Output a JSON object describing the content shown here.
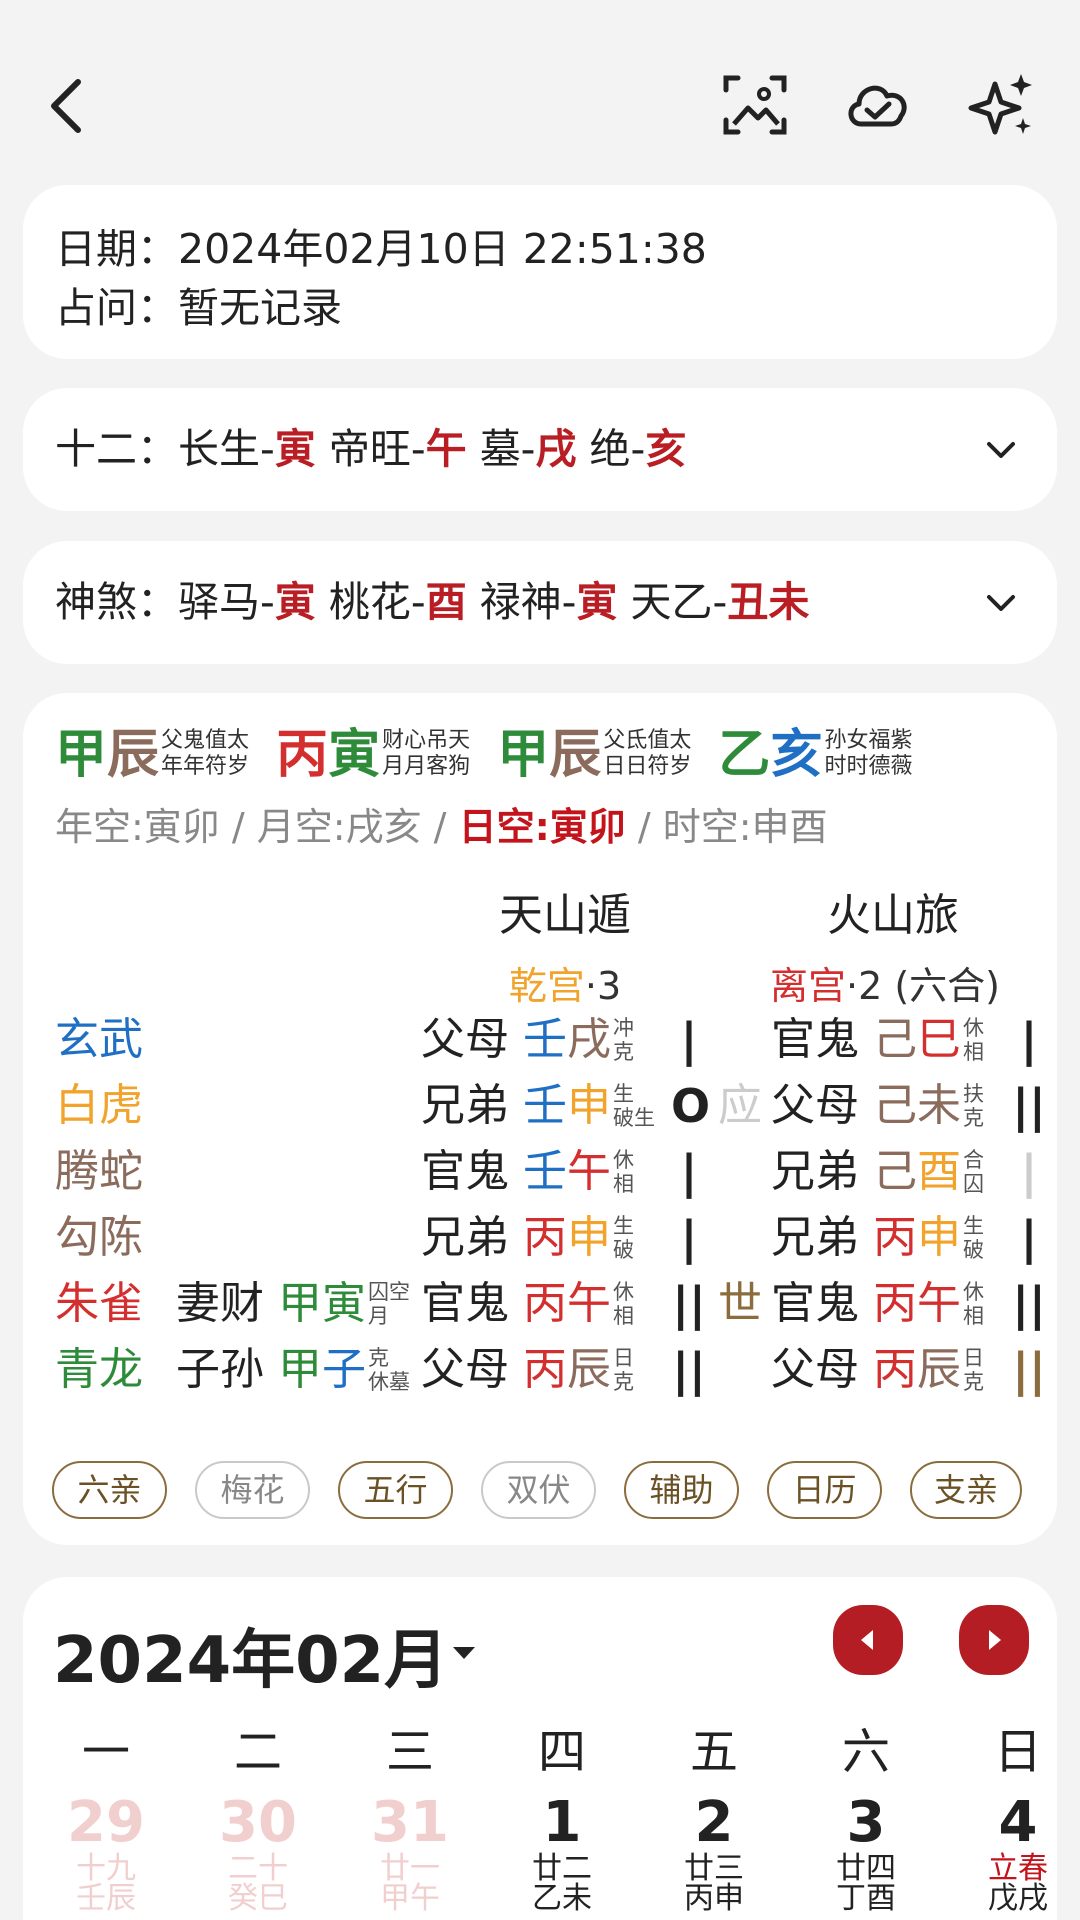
{
  "info": {
    "date_label": "日期：",
    "date_value": "2024年02月10日 22:51:38",
    "question_label": "占问：",
    "question_value": "暂无记录"
  },
  "twelve": {
    "label": "十二：",
    "items": [
      {
        "name": "长生-",
        "branch": "寅"
      },
      {
        "name": "帝旺-",
        "branch": "午"
      },
      {
        "name": "墓-",
        "branch": "戌"
      },
      {
        "name": "绝-",
        "branch": "亥"
      }
    ]
  },
  "shensha": {
    "label": "神煞：",
    "items": [
      {
        "name": "驿马-",
        "branch": "寅"
      },
      {
        "name": "桃花-",
        "branch": "酉"
      },
      {
        "name": "禄神-",
        "branch": "寅"
      },
      {
        "name": "天乙-",
        "branch": "丑未"
      }
    ]
  },
  "pillars": [
    {
      "stem": "甲",
      "branch": "辰",
      "sub1": "父鬼值太",
      "sub2": "年年符岁"
    },
    {
      "stem": "丙",
      "branch": "寅",
      "sub1": "财心吊天",
      "sub2": "月月客狗"
    },
    {
      "stem": "甲",
      "branch": "辰",
      "sub1": "父氐值太",
      "sub2": "日日符岁"
    },
    {
      "stem": "乙",
      "branch": "亥",
      "sub1": "孙女福紫",
      "sub2": "时时德薇"
    }
  ],
  "kong": {
    "year": "年空:寅卯",
    "sep": " / ",
    "month": "月空:戌亥",
    "day": "日空:寅卯",
    "hour": "时空:申酉"
  },
  "gua": {
    "main_name": "天山遁",
    "main_palace": "乾宫",
    "main_num": "·3",
    "change_name": "火山旅",
    "change_palace": "离宫",
    "change_num": "·2 (六合)"
  },
  "yao": [
    {
      "god": "玄武",
      "fu": "",
      "fu_s": "",
      "fu_b": "",
      "fu_sup1": "",
      "fu_sup2": "",
      "rel": "父母",
      "stem": "壬",
      "branch": "戌",
      "sup1": "冲",
      "sup2": "克",
      "sym": "|",
      "mark": "",
      "c_rel": "官鬼",
      "c_stem": "己",
      "c_branch": "巳",
      "c_sup1": "休",
      "c_sup2": "相",
      "c_sym": "|"
    },
    {
      "god": "白虎",
      "fu": "",
      "fu_s": "",
      "fu_b": "",
      "fu_sup1": "",
      "fu_sup2": "",
      "rel": "兄弟",
      "stem": "壬",
      "branch": "申",
      "sup1": "生",
      "sup2": "破生",
      "sym": "O",
      "mark": "应",
      "c_rel": "父母",
      "c_stem": "己",
      "c_branch": "未",
      "c_sup1": "扶",
      "c_sup2": "克",
      "c_sym": "||"
    },
    {
      "god": "腾蛇",
      "fu": "",
      "fu_s": "",
      "fu_b": "",
      "fu_sup1": "",
      "fu_sup2": "",
      "rel": "官鬼",
      "stem": "壬",
      "branch": "午",
      "sup1": "休",
      "sup2": "相",
      "sym": "|",
      "mark": "",
      "c_rel": "兄弟",
      "c_stem": "己",
      "c_branch": "酉",
      "c_sup1": "合",
      "c_sup2": "囚",
      "c_sym": "|"
    },
    {
      "god": "勾陈",
      "fu": "",
      "fu_s": "",
      "fu_b": "",
      "fu_sup1": "",
      "fu_sup2": "",
      "rel": "兄弟",
      "stem": "丙",
      "branch": "申",
      "sup1": "生",
      "sup2": "破",
      "sym": "|",
      "mark": "",
      "c_rel": "兄弟",
      "c_stem": "丙",
      "c_branch": "申",
      "c_sup1": "生",
      "c_sup2": "破",
      "c_sym": "|"
    },
    {
      "god": "朱雀",
      "fu": "妻财",
      "fu_s": "甲",
      "fu_b": "寅",
      "fu_sup1": "囚空",
      "fu_sup2": "月",
      "rel": "官鬼",
      "stem": "丙",
      "branch": "午",
      "sup1": "休",
      "sup2": "相",
      "sym": "||",
      "mark": "世",
      "c_rel": "官鬼",
      "c_stem": "丙",
      "c_branch": "午",
      "c_sup1": "休",
      "c_sup2": "相",
      "c_sym": "||"
    },
    {
      "god": "青龙",
      "fu": "子孙",
      "fu_s": "甲",
      "fu_b": "子",
      "fu_sup1": "克",
      "fu_sup2": "休墓",
      "rel": "父母",
      "stem": "丙",
      "branch": "辰",
      "sup1": "日",
      "sup2": "克",
      "sym": "||",
      "mark": "",
      "c_rel": "父母",
      "c_stem": "丙",
      "c_branch": "辰",
      "c_sup1": "日",
      "c_sup2": "克",
      "c_sym": "||"
    }
  ],
  "chips": [
    "六亲",
    "梅花",
    "五行",
    "双伏",
    "辅助",
    "日历",
    "支亲"
  ],
  "calendar": {
    "title": "2024年02月",
    "weekdays": [
      "一",
      "二",
      "三",
      "四",
      "五",
      "六",
      "日"
    ],
    "days": [
      {
        "num": "29",
        "l1": "十九",
        "l2": "壬辰"
      },
      {
        "num": "30",
        "l1": "二十",
        "l2": "癸巳"
      },
      {
        "num": "31",
        "l1": "廿一",
        "l2": "甲午"
      },
      {
        "num": "1",
        "l1": "廿二",
        "l2": "乙未"
      },
      {
        "num": "2",
        "l1": "廿三",
        "l2": "丙申"
      },
      {
        "num": "3",
        "l1": "廿四",
        "l2": "丁酉"
      },
      {
        "num": "4",
        "l1": "立春",
        "l2": "戊戌"
      }
    ]
  },
  "colors": {
    "accent": "#b51d24",
    "card": "#ffffff",
    "background": "#f3f3f3"
  }
}
